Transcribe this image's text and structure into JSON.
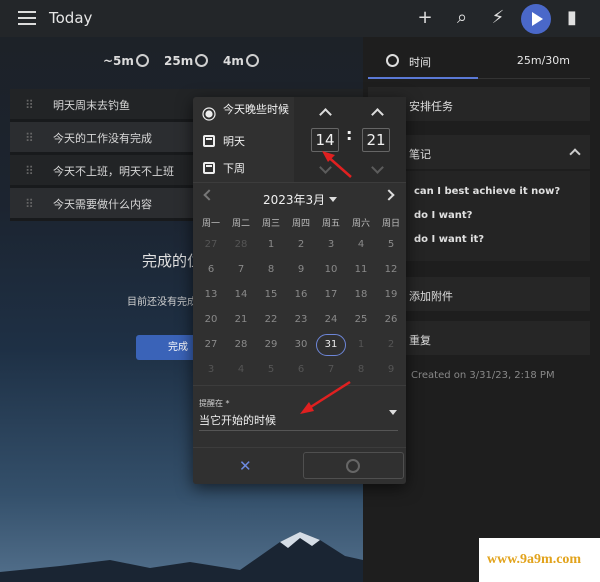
{
  "app": {
    "title": "Today"
  },
  "toolbar": {
    "add_icon": "+",
    "search_icon": "⌕",
    "bolt_icon": "⚡",
    "chat_icon": "▮"
  },
  "estimates": {
    "approx": "~5m",
    "total": "25m",
    "timer": "4m"
  },
  "tasks": [
    {
      "text": "明天周末去钓鱼"
    },
    {
      "text": "今天的工作没有完成"
    },
    {
      "text": "今天不上班，明天不上班"
    },
    {
      "text": "今天需要做什么内容"
    }
  ],
  "done": {
    "title": "完成的位",
    "subtitle": "目前还没有完成",
    "button": "完成"
  },
  "right_panel": {
    "tab_time": "时间",
    "tab_estimate": "25m/30m",
    "schedule": "安排任务",
    "notes": "笔记",
    "note_lines": [
      "can I best achieve it now?",
      "do I want?",
      "do I want it?"
    ],
    "attach": "添加附件",
    "repeat": "重复",
    "created": "Created on 3/31/23, 2:18 PM"
  },
  "popup": {
    "quick_options": [
      "今天晚些时候",
      "明天",
      "下周"
    ],
    "hour": "14",
    "minute": "21",
    "colon": ":",
    "month_label": "2023年3月",
    "weekdays": [
      "周一",
      "周二",
      "周三",
      "周四",
      "周五",
      "周六",
      "周日"
    ],
    "days": [
      [
        "27",
        "28",
        "1",
        "2",
        "3",
        "4",
        "5"
      ],
      [
        "6",
        "7",
        "8",
        "9",
        "10",
        "11",
        "12"
      ],
      [
        "13",
        "14",
        "15",
        "16",
        "17",
        "18",
        "19"
      ],
      [
        "20",
        "21",
        "22",
        "23",
        "24",
        "25",
        "26"
      ],
      [
        "27",
        "28",
        "29",
        "30",
        "31",
        "1",
        "2"
      ],
      [
        "3",
        "4",
        "5",
        "6",
        "7",
        "8",
        "9"
      ]
    ],
    "selected_day": "31",
    "remind_label": "提醒在 *",
    "remind_value": "当它开始的时候",
    "cancel_icon": "✕"
  },
  "colors": {
    "accent": "#5b79d6",
    "arrow": "#e02020",
    "play": "#4a68c9"
  },
  "watermark": "www.9a9m.com"
}
